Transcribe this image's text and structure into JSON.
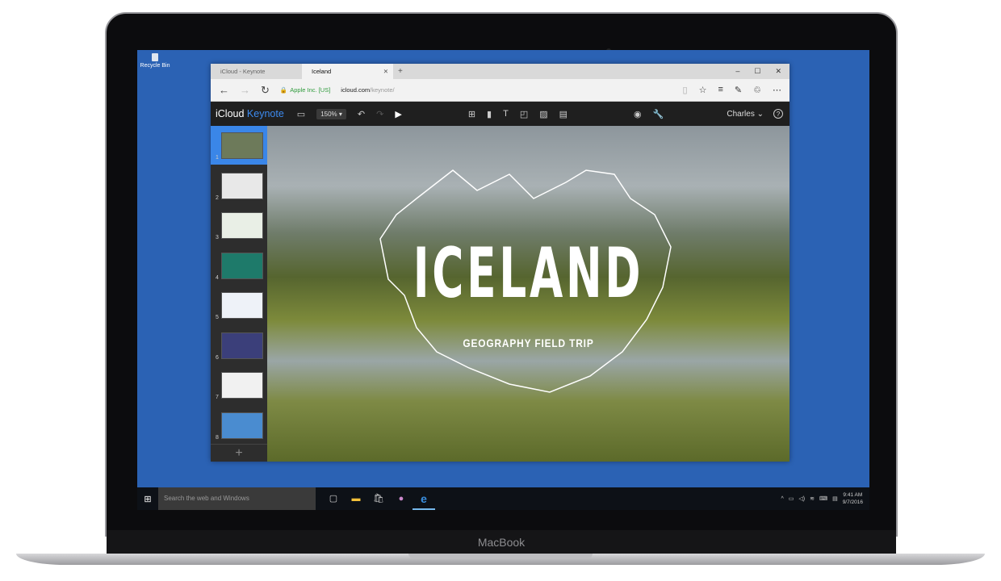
{
  "device": {
    "label": "MacBook"
  },
  "desktop": {
    "recycle_bin": "Recycle Bin"
  },
  "browser": {
    "tabs": [
      {
        "label": "iCloud - Keynote",
        "active": false
      },
      {
        "label": "Iceland",
        "active": true
      }
    ],
    "new_tab": "+",
    "window_controls": {
      "minimize": "–",
      "maximize": "☐",
      "close": "✕"
    },
    "cert": "Apple Inc. [US]",
    "url_domain": "icloud.com",
    "url_path": "/keynote/"
  },
  "keynote": {
    "brand_a": "iCloud",
    "brand_b": "Keynote",
    "zoom": "150% ▾",
    "user": "Charles ⌄",
    "help": "?",
    "slides": [
      1,
      2,
      3,
      4,
      5,
      6,
      7,
      8
    ],
    "selected_slide": 1,
    "add_slide": "+"
  },
  "slide": {
    "title": "ICELAND",
    "subtitle": "GEOGRAPHY FIELD TRIP"
  },
  "taskbar": {
    "search_placeholder": "Search the web and Windows",
    "time": "9:41 AM",
    "date": "9/7/2016"
  }
}
